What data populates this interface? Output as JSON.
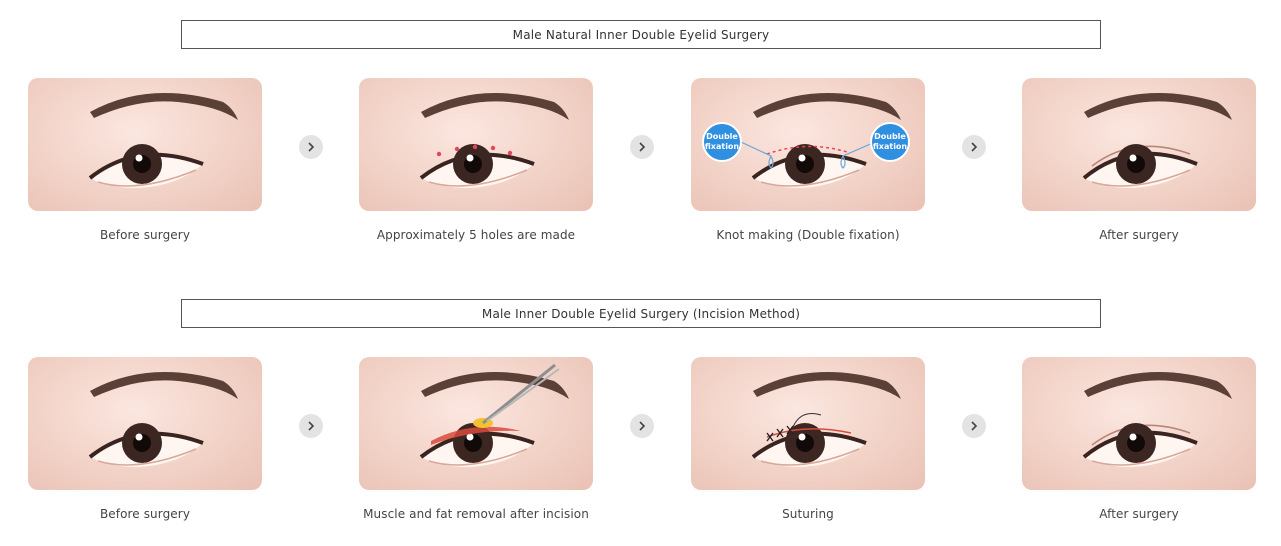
{
  "sections": [
    {
      "title": "Male Natural Inner Double Eyelid Surgery",
      "steps": [
        {
          "caption": "Before surgery"
        },
        {
          "caption": "Approximately 5 holes are made"
        },
        {
          "caption": "Knot making (Double fixation)",
          "badge_line1": "Double",
          "badge_line2": "fixation"
        },
        {
          "caption": "After surgery"
        }
      ]
    },
    {
      "title": "Male Inner Double Eyelid Surgery (Incision Method)",
      "steps": [
        {
          "caption": "Before surgery"
        },
        {
          "caption": "Muscle and fat removal after incision"
        },
        {
          "caption": "Suturing"
        },
        {
          "caption": "After surgery"
        }
      ]
    }
  ],
  "icons": {
    "next_arrow": "chevron-right-icon"
  },
  "colors": {
    "skin": "#f2d2c7",
    "badge": "#2f8fe0",
    "arrow_bg": "#e3e3e3",
    "hole_marks": "#e8435a",
    "incision": "#d94a3c"
  }
}
